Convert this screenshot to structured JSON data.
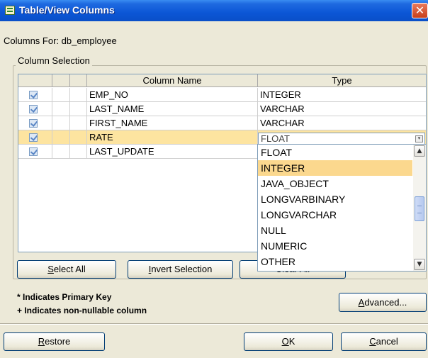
{
  "window": {
    "title": "Table/View Columns",
    "close_glyph": "✕"
  },
  "columns_for": "Columns For: db_employee",
  "group_label": "Column Selection",
  "table": {
    "headers": {
      "name": "Column Name",
      "type": "Type"
    },
    "rows": [
      {
        "checked": true,
        "name": "EMP_NO",
        "type": "INTEGER"
      },
      {
        "checked": true,
        "name": "LAST_NAME",
        "type": "VARCHAR"
      },
      {
        "checked": true,
        "name": "FIRST_NAME",
        "type": "VARCHAR"
      },
      {
        "checked": true,
        "name": "RATE",
        "type": "FLOAT",
        "selected": true
      },
      {
        "checked": true,
        "name": "LAST_UPDATE",
        "type": ""
      }
    ]
  },
  "type_dropdown": {
    "current_value": "FLOAT",
    "options": [
      "FLOAT",
      "INTEGER",
      "JAVA_OBJECT",
      "LONGVARBINARY",
      "LONGVARCHAR",
      "NULL",
      "NUMERIC",
      "OTHER"
    ],
    "highlighted": "INTEGER"
  },
  "buttons": {
    "select_all": {
      "mn": "S",
      "rest": "elect All"
    },
    "invert_selection": {
      "mn": "I",
      "rest": "nvert Selection"
    },
    "clear_all": {
      "label": "Clear All"
    },
    "advanced": {
      "mn": "A",
      "rest": "dvanced..."
    },
    "restore": {
      "mn": "R",
      "rest": "estore"
    },
    "ok": {
      "mn": "O",
      "rest": "K"
    },
    "cancel": {
      "mn": "C",
      "rest": "ancel"
    }
  },
  "notes": {
    "primary_key": "* Indicates Primary Key",
    "non_nullable": "+ Indicates non-nullable column"
  },
  "colors": {
    "selected_row": "#fde4a0",
    "highlight_option": "#fbd88e",
    "title_blue": "#0b56d6"
  }
}
